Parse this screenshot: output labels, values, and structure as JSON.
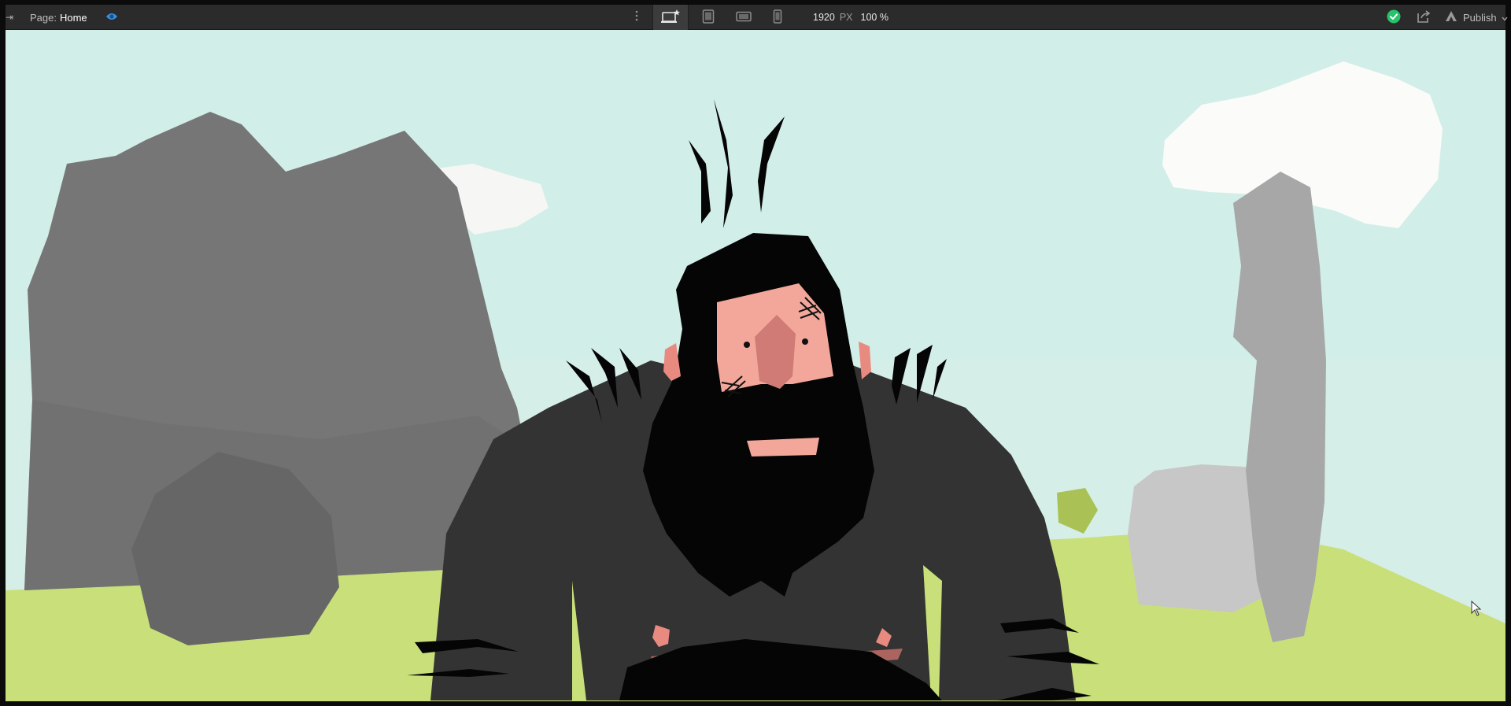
{
  "topbar": {
    "page_label": "Page:",
    "page_name": "Home",
    "canvas_width": "1920",
    "canvas_unit": "PX",
    "zoom": "100 %",
    "publish_label": "Publish"
  },
  "icons": {
    "preview": "eye-icon",
    "more": "vertical-dots-icon",
    "desktop": "desktop-star-icon",
    "tablet": "tablet-icon",
    "tablet_landscape": "tablet-landscape-icon",
    "phone": "phone-icon",
    "status": "check-circle-icon",
    "export": "share-export-icon",
    "publish": "publish-icon",
    "publish_menu": "chevron-down-icon"
  },
  "colors": {
    "topbar_bg": "#2b2b2b",
    "accent_blue": "#3b8fe0",
    "status_green": "#27c26b",
    "sky": "#d6eee8",
    "grass": "#c9e07a",
    "rock_dark": "#777777",
    "boulder": "#666666",
    "figure_coat": "#333333",
    "beard": "#050505",
    "skin": "#f2a79a"
  },
  "canvas": {
    "scene": "illustrated landscape with bearded caveman, grey rocks and clouds"
  }
}
